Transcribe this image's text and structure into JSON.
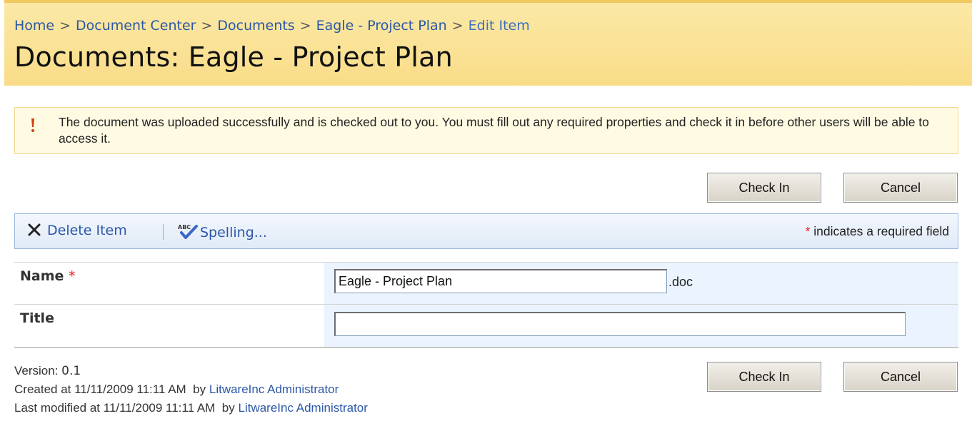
{
  "breadcrumb": {
    "items": [
      "Home",
      "Document Center",
      "Documents",
      "Eagle - Project Plan"
    ],
    "current": "Edit Item",
    "separator": ">"
  },
  "page_title": "Documents: Eagle - Project Plan",
  "status": {
    "icon": "exclamation-icon",
    "message": "The document was uploaded successfully and is checked out to you. You must fill out any required properties and check it in before other users will be able to access it."
  },
  "buttons": {
    "check_in": "Check In",
    "cancel": "Cancel"
  },
  "toolbar": {
    "delete_label": "Delete Item",
    "spelling_label": "Spelling...",
    "required_star": "*",
    "required_note": "indicates a required field"
  },
  "form": {
    "name": {
      "label": "Name",
      "required_star": "*",
      "value": "Eagle - Project Plan",
      "extension": ".doc"
    },
    "title": {
      "label": "Title",
      "value": ""
    }
  },
  "info": {
    "version_label": "Version:",
    "version": "0.1",
    "created_label": "Created at",
    "created_at": "11/11/2009 11:11 AM",
    "created_by_label": "by",
    "created_by": "LitwareInc Administrator",
    "modified_label": "Last modified at",
    "modified_at": "11/11/2009 11:11 AM",
    "modified_by_label": "by",
    "modified_by": "LitwareInc Administrator"
  },
  "colors": {
    "header_bg": "#f9dc88",
    "link": "#2b57a8",
    "toolbar_bg": "#e0eaf8",
    "status_bg": "#fffbe3",
    "required": "#dd2222"
  }
}
